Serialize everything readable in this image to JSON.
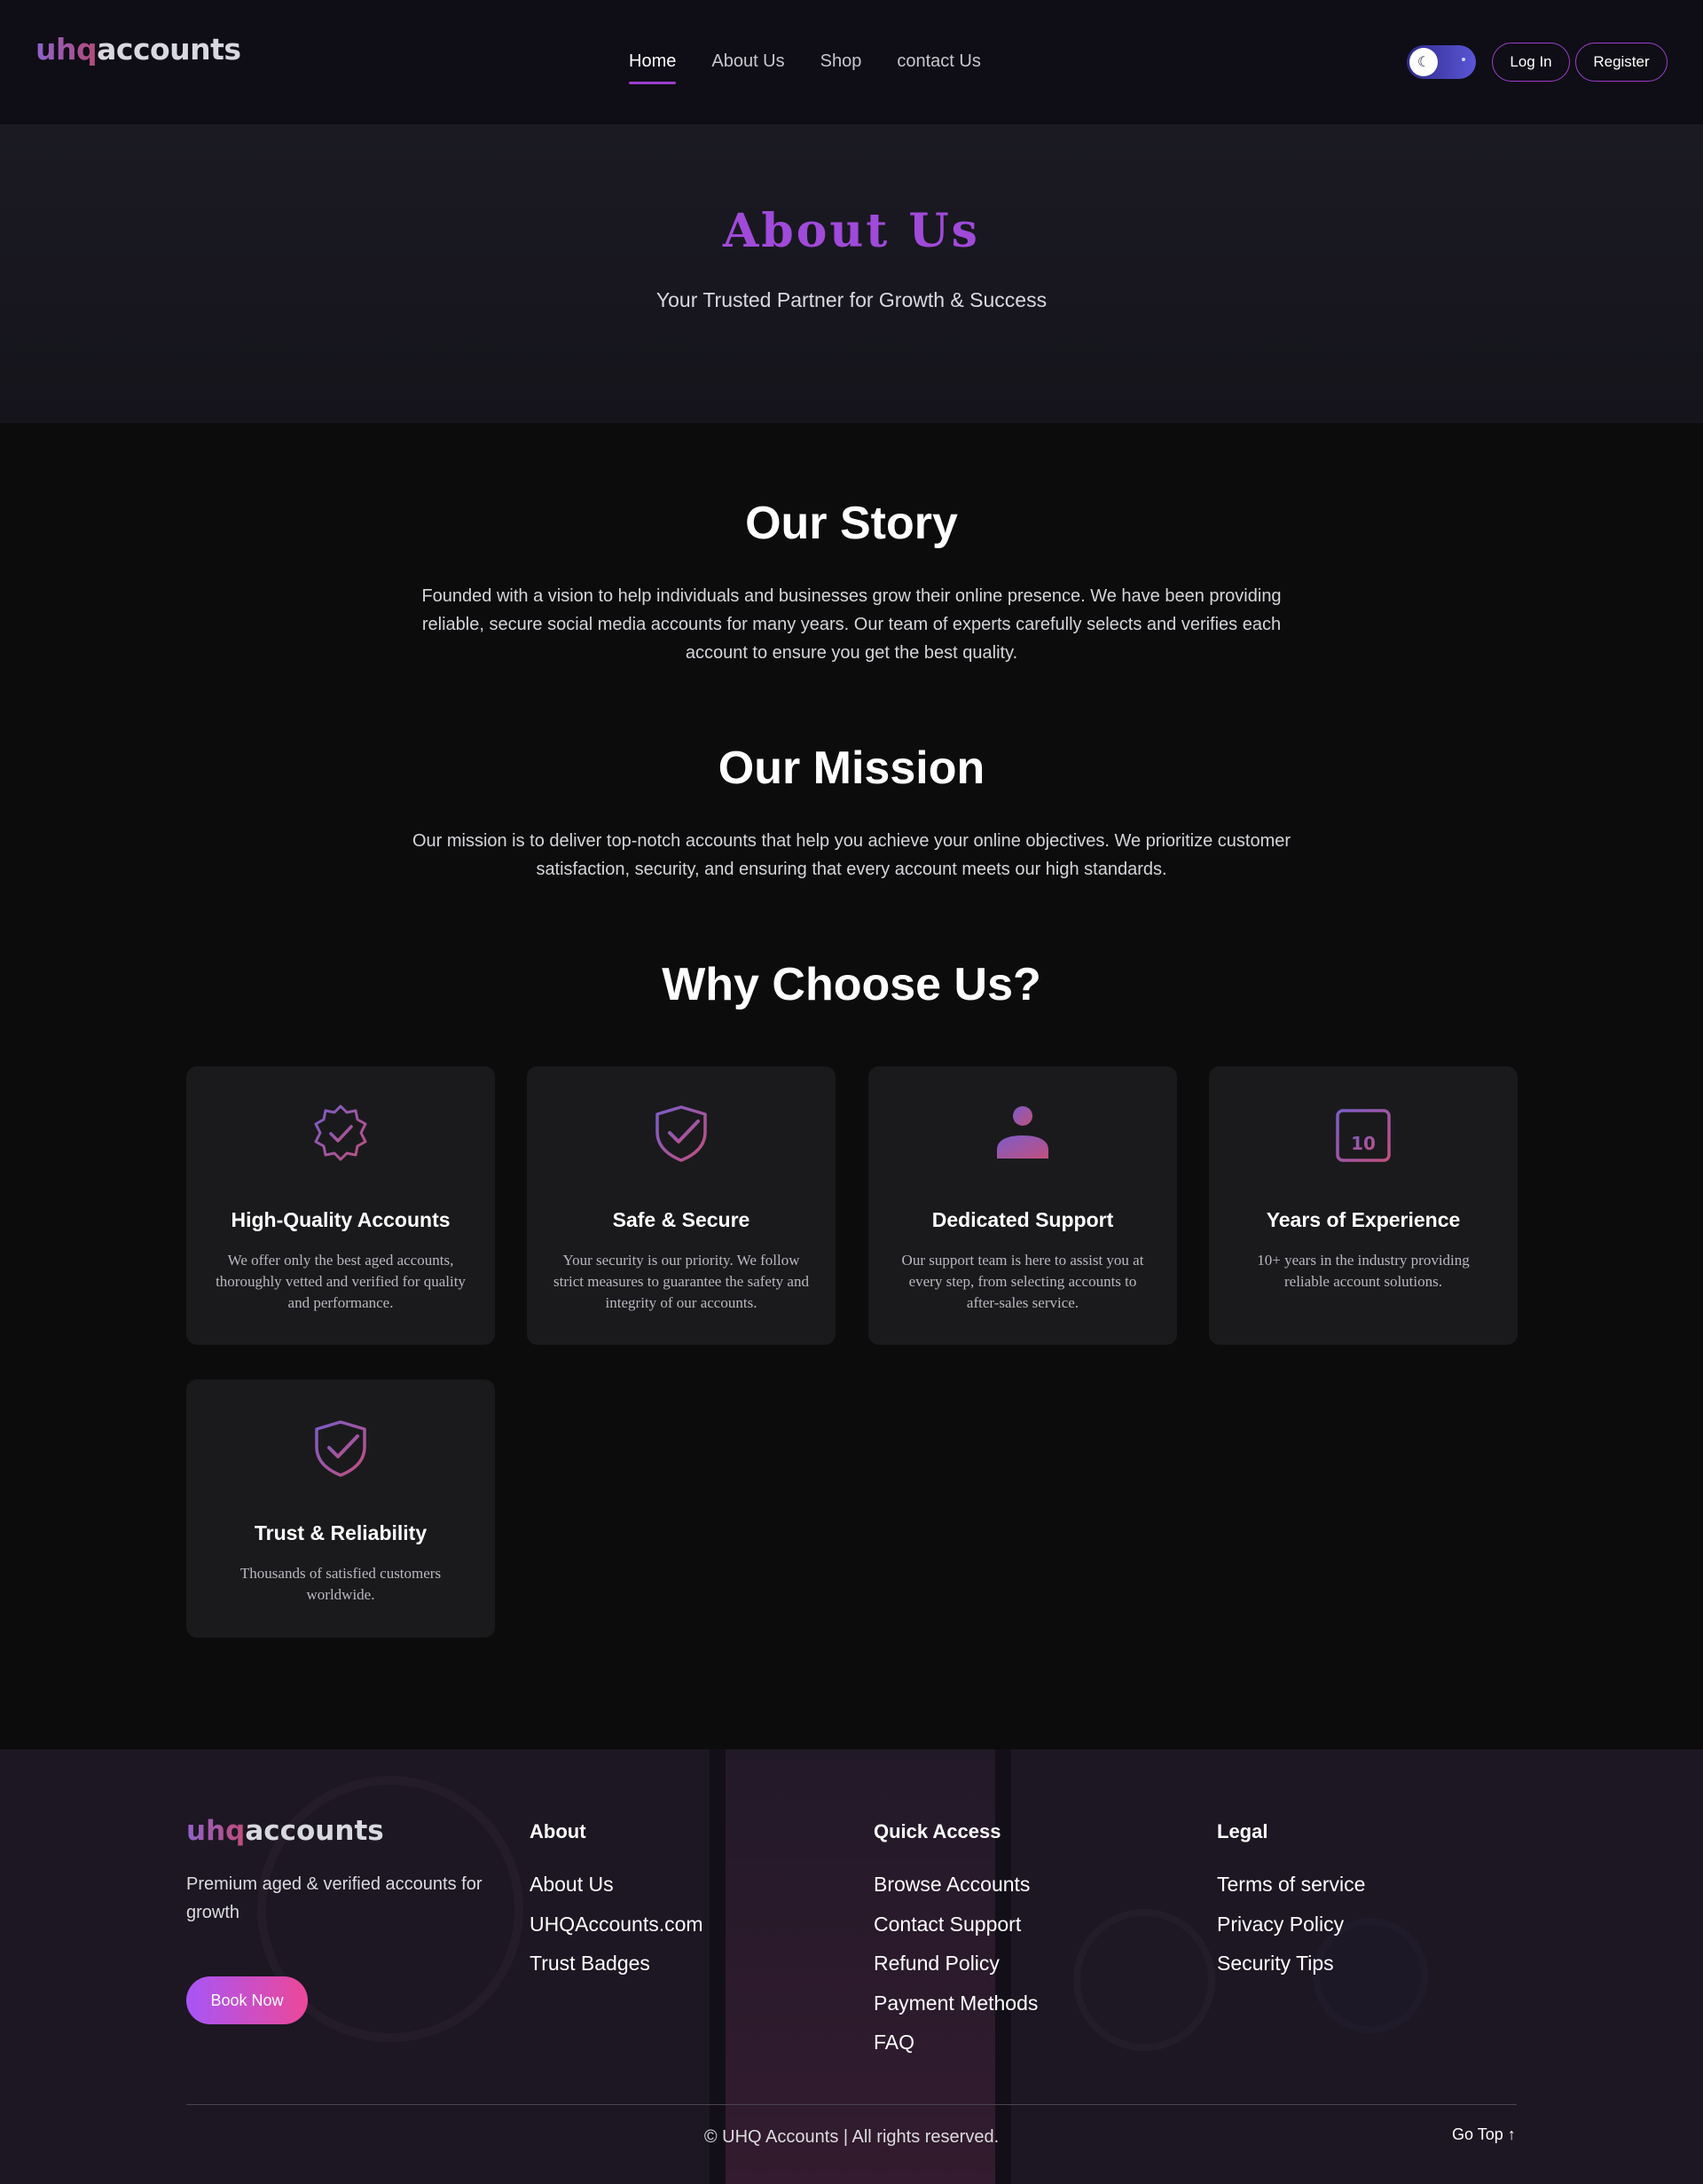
{
  "header": {
    "logo": {
      "part1": "uhq",
      "part2": "accounts"
    },
    "nav": [
      {
        "label": "Home",
        "active": true
      },
      {
        "label": "About Us",
        "active": false
      },
      {
        "label": "Shop",
        "active": false
      },
      {
        "label": "contact Us",
        "active": false
      }
    ],
    "theme_toggle_icon": "moon-icon",
    "login_label": "Log In",
    "register_label": "Register"
  },
  "hero": {
    "title": "About Us",
    "subtitle": "Your Trusted Partner for Growth & Success"
  },
  "story": {
    "title": "Our Story",
    "text": "Founded with a vision to help individuals and businesses grow their online presence. We have been providing reliable, secure social media accounts for many years. Our team of experts carefully selects and verifies each account to ensure you get the best quality."
  },
  "mission": {
    "title": "Our Mission",
    "text": "Our mission is to deliver top-notch accounts that help you achieve your online objectives. We prioritize customer satisfaction, security, and ensuring that every account meets our high standards."
  },
  "why": {
    "title": "Why Choose Us?",
    "cards": [
      {
        "icon": "verified-badge-icon",
        "title": "High-Quality Accounts",
        "text": "We offer only the best aged accounts, thoroughly vetted and verified for quality and performance."
      },
      {
        "icon": "shield-check-icon",
        "title": "Safe & Secure",
        "text": "Your security is our priority. We follow strict measures to guarantee the safety and integrity of our accounts."
      },
      {
        "icon": "user-icon",
        "title": "Dedicated Support",
        "text": "Our support team is here to assist you at every step, from selecting accounts to after-sales service."
      },
      {
        "icon": "calendar-icon",
        "calendar_number": "10",
        "title": "Years of Experience",
        "text": "10+ years in the industry providing reliable account solutions."
      },
      {
        "icon": "shield-check-icon",
        "title": "Trust & Reliability",
        "text": "Thousands of satisfied customers worldwide."
      }
    ]
  },
  "footer": {
    "logo": {
      "part1": "uhq",
      "part2": "accounts"
    },
    "tagline": "Premium aged & verified accounts for growth",
    "book_label": "Book Now",
    "columns": [
      {
        "title": "About",
        "links": [
          "About Us",
          "UHQAccounts.com",
          "Trust Badges"
        ]
      },
      {
        "title": "Quick Access",
        "links": [
          "Browse Accounts",
          "Contact Support",
          "Refund Policy",
          "Payment Methods",
          "FAQ"
        ]
      },
      {
        "title": "Legal",
        "links": [
          "Terms of service",
          "Privacy Policy",
          "Security Tips"
        ]
      }
    ],
    "copyright": "© UHQ Accounts | All rights reserved.",
    "go_top_label": "Go Top ↑"
  },
  "colors": {
    "accent": "#9b3fd0",
    "hero_title": "#a04ad9",
    "icon_gradient_start": "#7c5cc9",
    "icon_gradient_end": "#c0507e"
  }
}
